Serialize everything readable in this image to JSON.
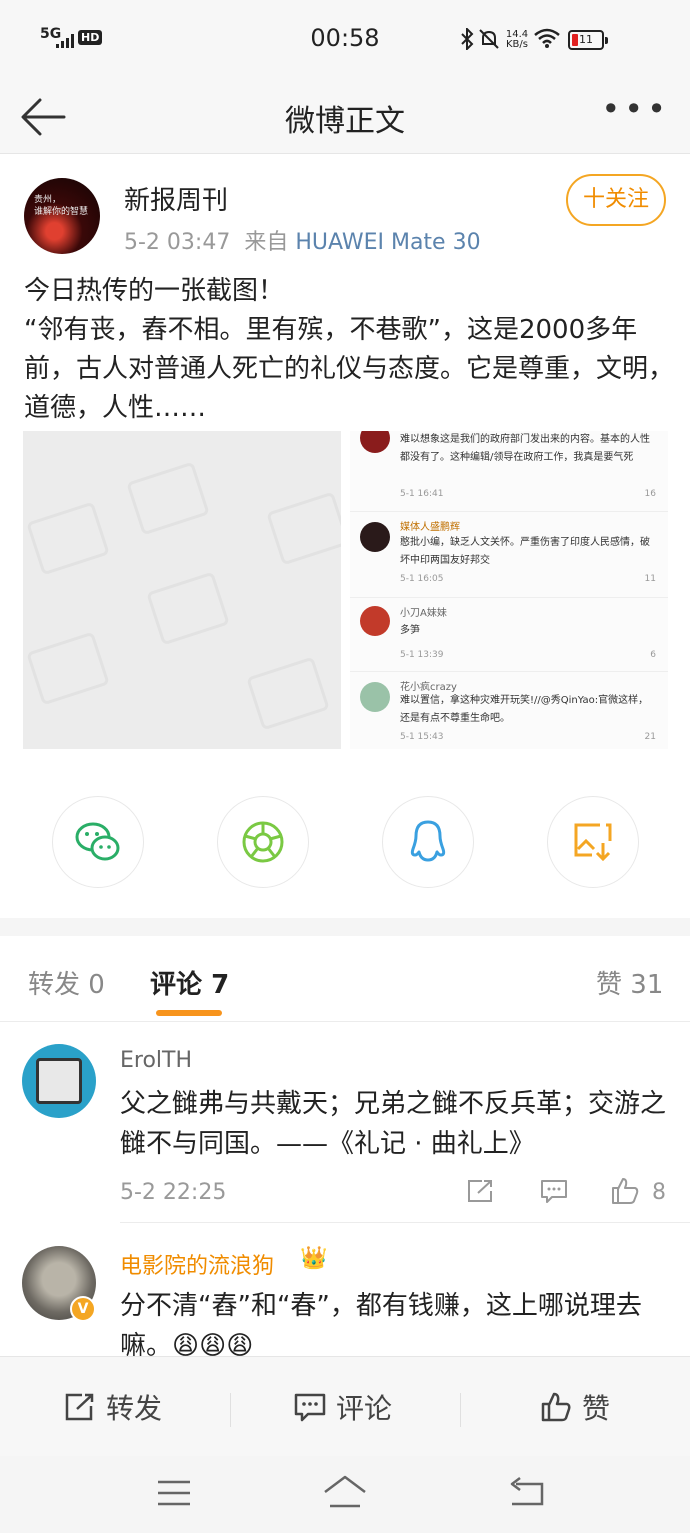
{
  "status_bar": {
    "network": "5G",
    "hd": "HD",
    "time": "00:58",
    "speed_value": "14.4",
    "speed_unit": "KB/s",
    "battery": "11",
    "icons": [
      "signal-icon",
      "bluetooth-icon",
      "mute-icon",
      "wifi-icon",
      "battery-icon"
    ]
  },
  "nav": {
    "title": "微博正文",
    "more": "•••"
  },
  "post": {
    "avatar_text": "贵州，\n谁解你的智慧",
    "author": "新报周刊",
    "date": "5-2 03:47",
    "source_prefix": "来自",
    "source": "HUAWEI Mate 30",
    "follow": "十关注",
    "content": [
      "今日热传的一张截图！",
      "“邻有丧，舂不相。里有殡，不巷歌”，这是2000多年前，古人对普通人死亡的礼仪与态度。它是尊重，文明，道德，人性……"
    ],
    "screenshot_comments": [
      {
        "name": "",
        "text": "难以想象这是我们的政府部门发出来的内容。基本的人性都没有了。这种编辑/领导在政府工作，我真是要气死",
        "date": "5-1 16:41",
        "likes": "16"
      },
      {
        "name": "媒体人盛鹏辉",
        "text": "憨批小编，缺乏人文关怀。严重伤害了印度人民感情，破坏中印两国友好邦交",
        "date": "5-1 16:05",
        "likes": "11"
      },
      {
        "name": "小刀A妹妹",
        "text": "多笋",
        "date": "5-1 13:39",
        "likes": "6"
      },
      {
        "name": "花小疯crazy",
        "text": "难以置信，拿这种灾难开玩笑!//@秀QinYao:官微这样，还是有点不尊重生命吧。",
        "date": "5-1 15:43",
        "likes": "21"
      }
    ]
  },
  "share": [
    {
      "name": "wechat-icon",
      "color": "#2aae67"
    },
    {
      "name": "moments-icon",
      "color": "#7ac943"
    },
    {
      "name": "qq-icon",
      "color": "#3aa0e0"
    },
    {
      "name": "save-image-icon",
      "color": "#f4a623"
    }
  ],
  "tabs": [
    {
      "label": "转发",
      "count": "0"
    },
    {
      "label": "评论",
      "count": "7"
    },
    {
      "label": "赞",
      "count": "31"
    }
  ],
  "comments": [
    {
      "name": "ErolTH",
      "text": "父之雠弗与共戴天；兄弟之雠不反兵革；交游之雠不与同国。——《礼记 · 曲礼上》",
      "date": "5-2 22:25",
      "likes": "8"
    },
    {
      "name": "电影院的流浪狗",
      "text": "分不清“舂”和“春”，都有钱赚，这上哪说理去嘛。",
      "emoji": "😩😩😩"
    }
  ],
  "bottom_bar": {
    "repost": "转发",
    "comment": "评论",
    "like": "赞"
  },
  "colors": {
    "accent": "#f7941d",
    "link": "#5b83ad",
    "vip_name": "#f08c00"
  }
}
